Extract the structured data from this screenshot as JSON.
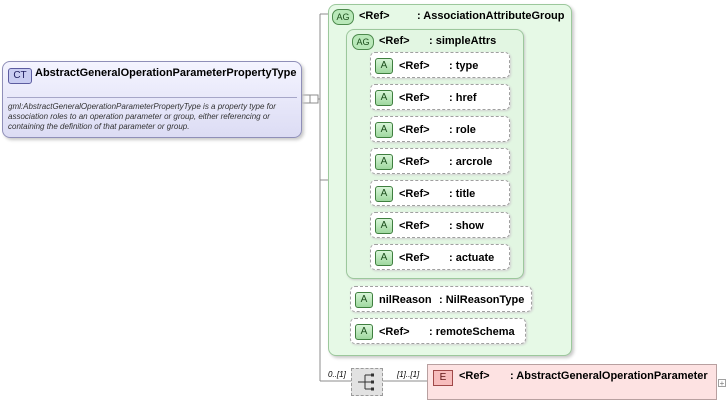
{
  "complex_type": {
    "badge": "CT",
    "name": "AbstractGeneralOperationParameterPropertyType",
    "documentation": "gml:AbstractGeneralOperationParameterPropertyType is a property type for association roles to an operation parameter or group, either referencing or containing the definition of that parameter or group."
  },
  "attribute_group": {
    "badge": "AG",
    "ref": "<Ref>",
    "name": ": AssociationAttributeGroup",
    "inner_group": {
      "badge": "AG",
      "ref": "<Ref>",
      "name": ": simpleAttrs",
      "attributes": [
        {
          "badge": "A",
          "ref": "<Ref>",
          "name": ": type"
        },
        {
          "badge": "A",
          "ref": "<Ref>",
          "name": ": href"
        },
        {
          "badge": "A",
          "ref": "<Ref>",
          "name": ": role"
        },
        {
          "badge": "A",
          "ref": "<Ref>",
          "name": ": arcrole"
        },
        {
          "badge": "A",
          "ref": "<Ref>",
          "name": ": title"
        },
        {
          "badge": "A",
          "ref": "<Ref>",
          "name": ": show"
        },
        {
          "badge": "A",
          "ref": "<Ref>",
          "name": ": actuate"
        }
      ]
    },
    "nil_reason": {
      "badge": "A",
      "ref": "nilReason",
      "name": ": NilReasonType"
    },
    "remote_schema": {
      "badge": "A",
      "ref": "<Ref>",
      "name": ": remoteSchema"
    }
  },
  "sequence": {
    "cardinality": "0..[1]"
  },
  "element": {
    "badge": "E",
    "ref": "<Ref>",
    "name": ": AbstractGeneralOperationParameter",
    "cardinality": "[1]..[1]",
    "expand": "+"
  },
  "colors": {
    "complex_type_fill": "#dcdcf4",
    "attribute_group_fill": "#e6f9e6",
    "attribute_fill": "#ffffff",
    "element_fill": "#fde2e2",
    "connector": "#8c8c8c"
  }
}
